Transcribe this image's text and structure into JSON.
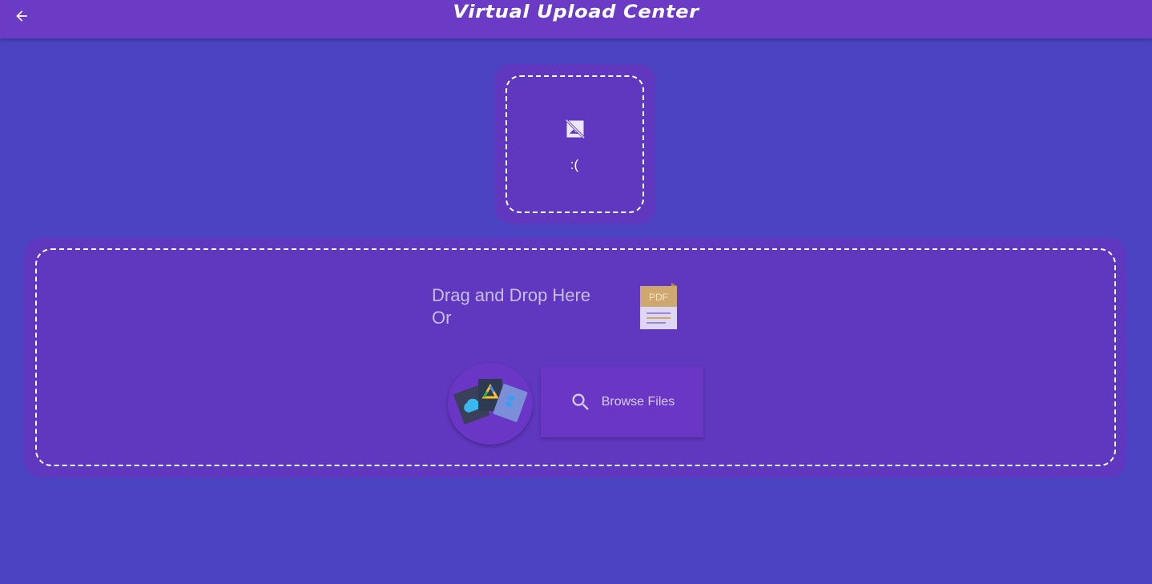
{
  "header": {
    "title": "Virtual Upload Center",
    "back_icon": "arrow-left-icon"
  },
  "preview": {
    "icon": "no-image-icon",
    "message": ":("
  },
  "dropzone": {
    "line1": "Drag and Drop Here",
    "line2": "Or",
    "file_icon": "pdf-file-icon",
    "file_icon_label": "PDF",
    "cloud_icon": "cloud-storage-icon",
    "browse": {
      "icon": "search-icon",
      "label": "Browse Files"
    }
  },
  "colors": {
    "background": "#4b43c2",
    "appbar": "#6b3bc6",
    "card": "#6038c0",
    "button": "#6a36c6"
  }
}
